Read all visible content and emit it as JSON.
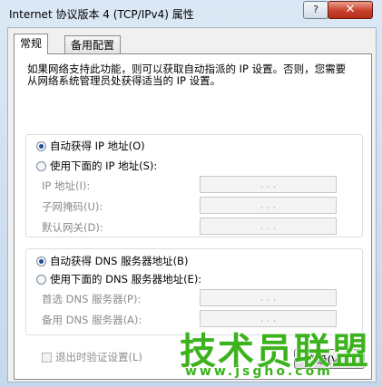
{
  "window": {
    "title": "Internet 协议版本 4 (TCP/IPv4) 属性"
  },
  "titlebar": {
    "help_label": "?",
    "close_label": "✕"
  },
  "tabs": [
    {
      "label": "常规"
    },
    {
      "label": "备用配置"
    }
  ],
  "description": "如果网络支持此功能，则可以获取自动指派的 IP 设置。否则，您需要从网络系统管理员处获得适当的 IP 设置。",
  "ip": {
    "auto_label": "自动获得 IP 地址(O)",
    "manual_label": "使用下面的 IP 地址(S):",
    "fields": [
      {
        "label": "IP 地址(I):",
        "value": ".   .   ."
      },
      {
        "label": "子网掩码(U):",
        "value": ".   .   ."
      },
      {
        "label": "默认网关(D):",
        "value": ".   .   ."
      }
    ]
  },
  "dns": {
    "auto_label": "自动获得 DNS 服务器地址(B)",
    "manual_label": "使用下面的 DNS 服务器地址(E):",
    "fields": [
      {
        "label": "首选 DNS 服务器(P):",
        "value": ".   .   ."
      },
      {
        "label": "备用 DNS 服务器(A):",
        "value": ".   .   ."
      }
    ]
  },
  "validate_label": "退出时验证设置(L)",
  "advanced_label": "高级(V)...",
  "watermark": {
    "title": "技术员联盟",
    "url": "www.jsgho.com"
  }
}
